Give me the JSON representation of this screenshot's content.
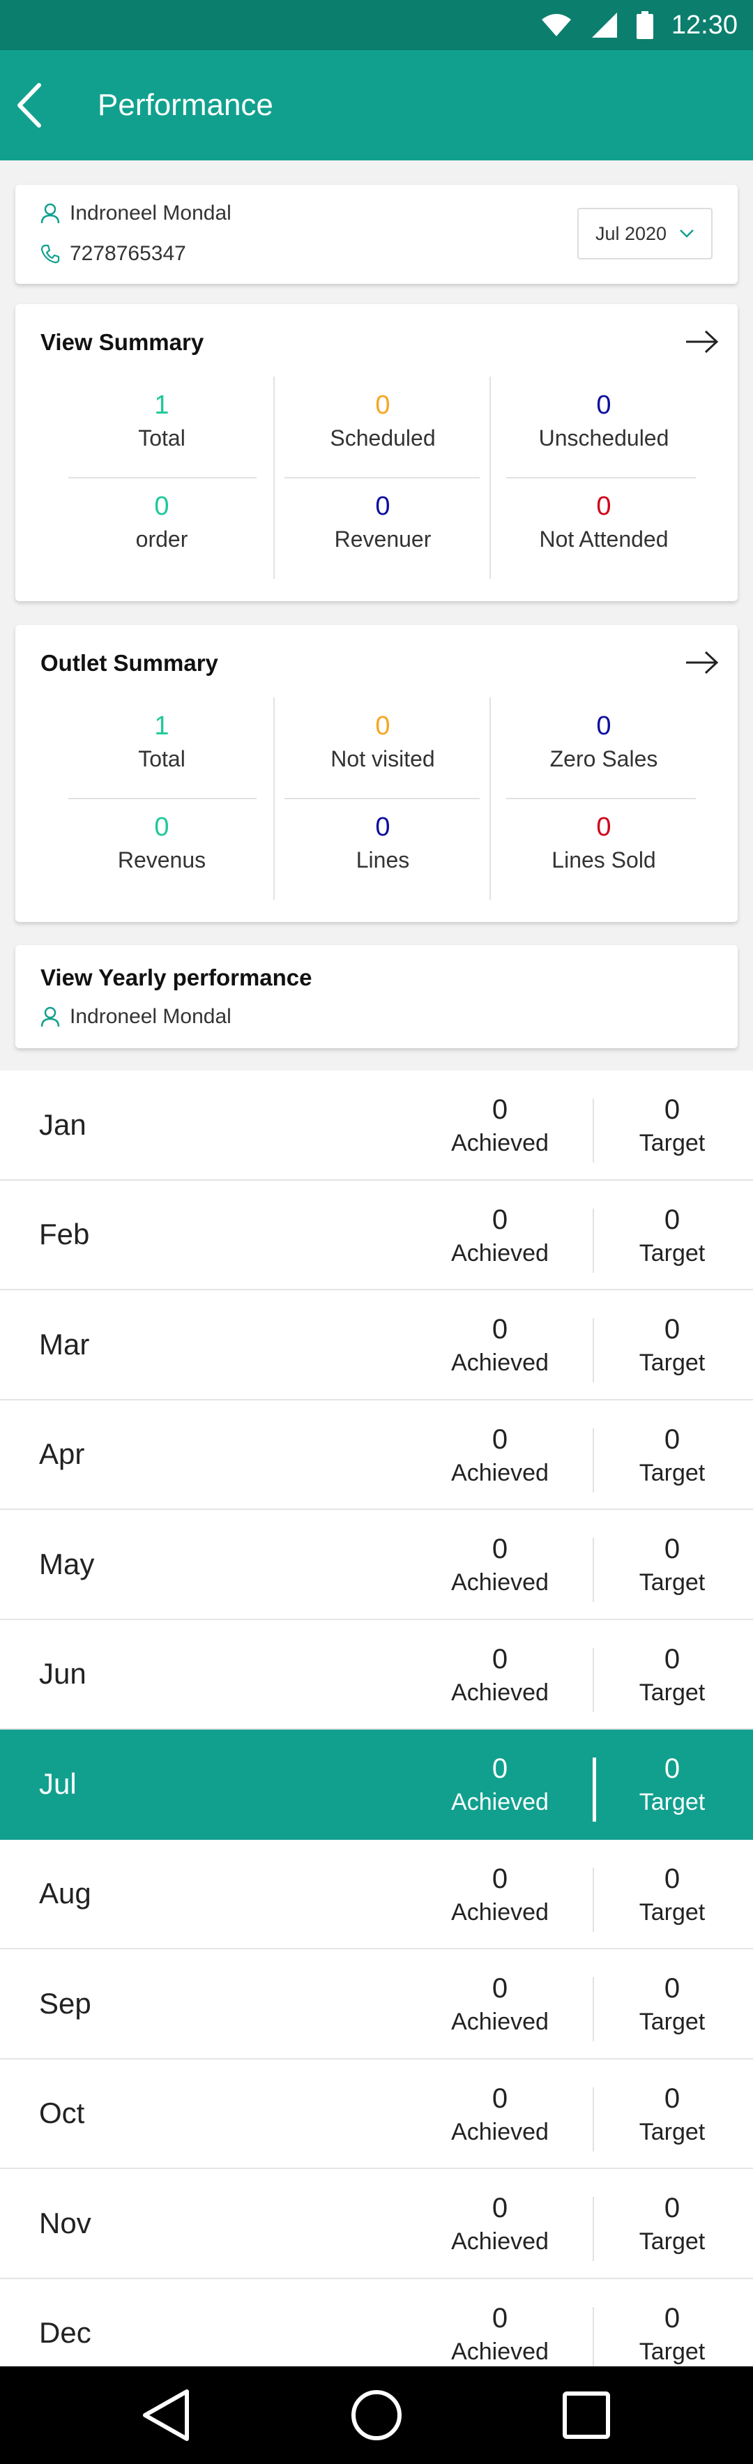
{
  "status_bar": {
    "time": "12:30",
    "icons": [
      "wifi-icon",
      "signal-icon",
      "battery-icon"
    ]
  },
  "header": {
    "title": "Performance",
    "back_icon": "back-arrow-icon"
  },
  "user": {
    "name": "Indroneel Mondal",
    "phone": "7278765347",
    "selected_month": "Jul 2020"
  },
  "view_summary": {
    "title": "View Summary",
    "stats": [
      {
        "value": "1",
        "label": "Total",
        "color": "#1fc89a"
      },
      {
        "value": "0",
        "label": "Scheduled",
        "color": "#f5a623"
      },
      {
        "value": "0",
        "label": "Unscheduled",
        "color": "#0d0d9e"
      },
      {
        "value": "0",
        "label": "order",
        "color": "#1fc89a"
      },
      {
        "value": "0",
        "label": "Revenuer",
        "color": "#0d0d9e"
      },
      {
        "value": "0",
        "label": "Not Attended",
        "color": "#d0021b"
      }
    ]
  },
  "outlet_summary": {
    "title": "Outlet Summary",
    "stats": [
      {
        "value": "1",
        "label": "Total",
        "color": "#1fc89a"
      },
      {
        "value": "0",
        "label": "Not visited",
        "color": "#f5a623"
      },
      {
        "value": "0",
        "label": "Zero Sales",
        "color": "#0d0d9e"
      },
      {
        "value": "0",
        "label": "Revenus",
        "color": "#1fc89a"
      },
      {
        "value": "0",
        "label": "Lines",
        "color": "#0d0d9e"
      },
      {
        "value": "0",
        "label": "Lines Sold",
        "color": "#d0021b"
      }
    ]
  },
  "yearly": {
    "title": "View Yearly performance",
    "user_name": "Indroneel Mondal",
    "achieved_label": "Achieved",
    "target_label": "Target",
    "months": [
      {
        "name": "Jan",
        "achieved": "0",
        "target": "0",
        "active": false
      },
      {
        "name": "Feb",
        "achieved": "0",
        "target": "0",
        "active": false
      },
      {
        "name": "Mar",
        "achieved": "0",
        "target": "0",
        "active": false
      },
      {
        "name": "Apr",
        "achieved": "0",
        "target": "0",
        "active": false
      },
      {
        "name": "May",
        "achieved": "0",
        "target": "0",
        "active": false
      },
      {
        "name": "Jun",
        "achieved": "0",
        "target": "0",
        "active": false
      },
      {
        "name": "Jul",
        "achieved": "0",
        "target": "0",
        "active": true
      },
      {
        "name": "Aug",
        "achieved": "0",
        "target": "0",
        "active": false
      },
      {
        "name": "Sep",
        "achieved": "0",
        "target": "0",
        "active": false
      },
      {
        "name": "Oct",
        "achieved": "0",
        "target": "0",
        "active": false
      },
      {
        "name": "Nov",
        "achieved": "0",
        "target": "0",
        "active": false
      },
      {
        "name": "Dec",
        "achieved": "0",
        "target": "0",
        "active": false
      }
    ]
  },
  "colors": {
    "primary": "#11a08e",
    "status_bar": "#0c7e6e",
    "accent_green": "#1fc89a",
    "orange": "#f5a623",
    "navy": "#0d0d9e",
    "red": "#d0021b"
  },
  "nav": {
    "buttons": [
      "back-triangle-icon",
      "home-circle-icon",
      "recents-square-icon"
    ]
  }
}
